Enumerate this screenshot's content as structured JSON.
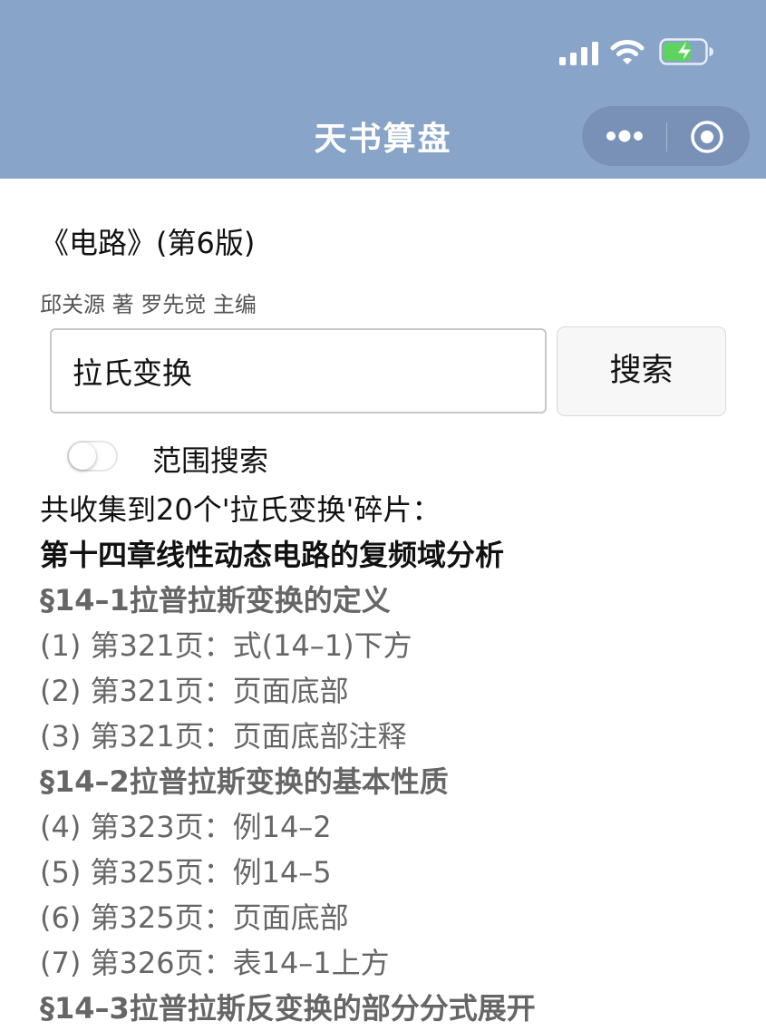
{
  "nav": {
    "title": "天书算盘"
  },
  "book": {
    "title": "《电路》(第6版)",
    "author": "邱关源 著 罗先觉 主编"
  },
  "search": {
    "value": "拉氏变换",
    "button_label": "搜索"
  },
  "scope_toggle": {
    "label": "范围搜索",
    "on": false
  },
  "results": {
    "summary": "共收集到20个'拉氏变换'碎片：",
    "lines": [
      {
        "kind": "chapter",
        "text": "第十四章线性动态电路的复频域分析"
      },
      {
        "kind": "section",
        "text": "§14–1拉普拉斯变换的定义"
      },
      {
        "kind": "item",
        "text": "(1) 第321页：式(14–1)下方"
      },
      {
        "kind": "item",
        "text": "(2) 第321页：页面底部"
      },
      {
        "kind": "item",
        "text": "(3) 第321页：页面底部注释"
      },
      {
        "kind": "section",
        "text": "§14–2拉普拉斯变换的基本性质"
      },
      {
        "kind": "item",
        "text": "(4) 第323页：例14–2"
      },
      {
        "kind": "item",
        "text": "(5) 第325页：例14–5"
      },
      {
        "kind": "item",
        "text": "(6) 第325页：页面底部"
      },
      {
        "kind": "item",
        "text": "(7) 第326页：表14–1上方"
      },
      {
        "kind": "section",
        "text": "§14–3拉普拉斯反变换的部分分式展开"
      }
    ]
  },
  "colors": {
    "header_bg": "#88a4c9",
    "battery_fill": "#5fd35f",
    "section_text": "#666666"
  },
  "icons": {
    "signal": "cellular-signal-icon",
    "wifi": "wifi-icon",
    "battery": "battery-charging-icon",
    "more": "more-dots-icon",
    "close": "close-miniprogram-icon"
  }
}
